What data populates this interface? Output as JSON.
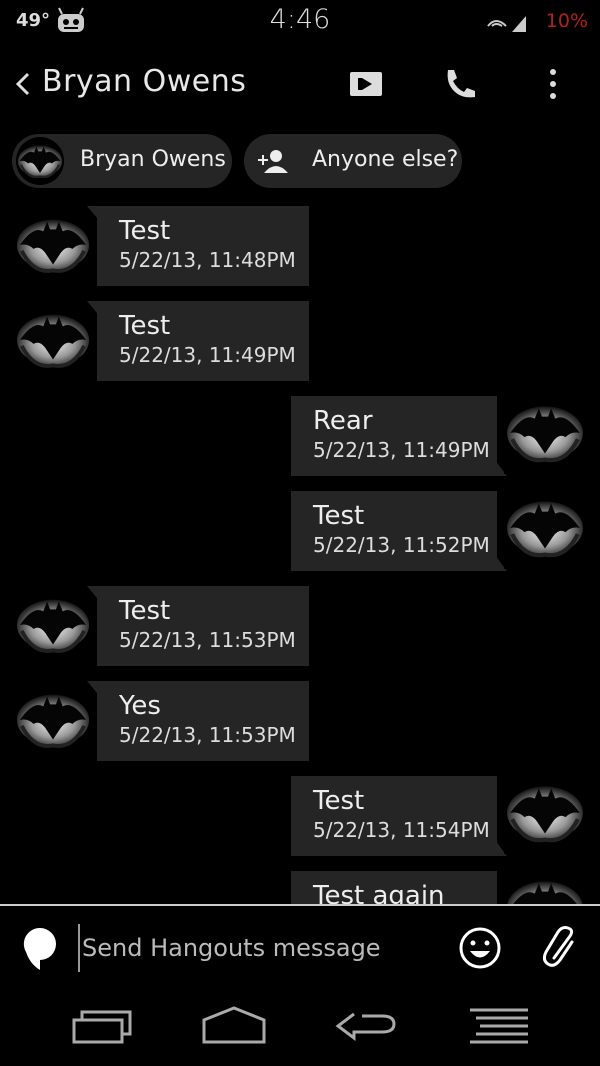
{
  "status": {
    "temperature": "49°",
    "time": "4:46",
    "battery": "10%"
  },
  "header": {
    "title": "Bryan Owens"
  },
  "chips": {
    "person_label": "Bryan Owens",
    "add_label": "Anyone else?"
  },
  "messages": [
    {
      "direction": "in",
      "text": "Test",
      "time": "5/22/13, 11:48PM"
    },
    {
      "direction": "in",
      "text": "Test",
      "time": "5/22/13, 11:49PM"
    },
    {
      "direction": "out",
      "text": "Rear",
      "time": "5/22/13, 11:49PM"
    },
    {
      "direction": "out",
      "text": "Test",
      "time": "5/22/13, 11:52PM"
    },
    {
      "direction": "in",
      "text": "Test",
      "time": "5/22/13, 11:53PM"
    },
    {
      "direction": "in",
      "text": "Yes",
      "time": "5/22/13, 11:53PM"
    },
    {
      "direction": "out",
      "text": "Test",
      "time": "5/22/13, 11:54PM"
    },
    {
      "direction": "out",
      "text": "Test again",
      "time": ""
    }
  ],
  "composer": {
    "placeholder": "Send Hangouts message"
  },
  "colors": {
    "background": "#000000",
    "bubble": "#252525",
    "battery": "#b02020"
  },
  "icons": [
    "back-icon",
    "video-call-icon",
    "phone-icon",
    "overflow-menu-icon",
    "add-person-icon",
    "hangouts-icon",
    "emoji-icon",
    "attach-icon",
    "recent-apps-icon",
    "home-icon",
    "back-nav-icon",
    "menu-nav-icon"
  ]
}
